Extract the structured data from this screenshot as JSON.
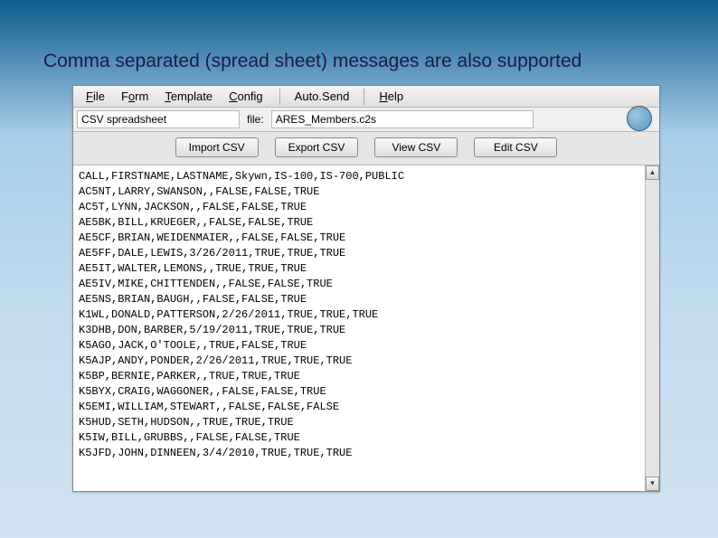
{
  "slide": {
    "title": "Comma separated (spread sheet) messages are also supported"
  },
  "menu": {
    "file": "File",
    "form": "Form",
    "template": "Template",
    "config": "Config",
    "autosend": "Auto.Send",
    "help": "Help"
  },
  "info": {
    "type": "CSV spreadsheet",
    "file_label": "file:",
    "file_name": "ARES_Members.c2s"
  },
  "buttons": {
    "import": "Import CSV",
    "export": "Export CSV",
    "view": "View CSV",
    "edit": "Edit CSV"
  },
  "csv_lines": [
    "CALL,FIRSTNAME,LASTNAME,Skywn,IS-100,IS-700,PUBLIC",
    "AC5NT,LARRY,SWANSON,,FALSE,FALSE,TRUE",
    "AC5T,LYNN,JACKSON,,FALSE,FALSE,TRUE",
    "AE5BK,BILL,KRUEGER,,FALSE,FALSE,TRUE",
    "AE5CF,BRIAN,WEIDENMAIER,,FALSE,FALSE,TRUE",
    "AE5FF,DALE,LEWIS,3/26/2011,TRUE,TRUE,TRUE",
    "AE5IT,WALTER,LEMONS,,TRUE,TRUE,TRUE",
    "AE5IV,MIKE,CHITTENDEN,,FALSE,FALSE,TRUE",
    "AE5NS,BRIAN,BAUGH,,FALSE,FALSE,TRUE",
    "K1WL,DONALD,PATTERSON,2/26/2011,TRUE,TRUE,TRUE",
    "K3DHB,DON,BARBER,5/19/2011,TRUE,TRUE,TRUE",
    "K5AGO,JACK,O'TOOLE,,TRUE,FALSE,TRUE",
    "K5AJP,ANDY,PONDER,2/26/2011,TRUE,TRUE,TRUE",
    "K5BP,BERNIE,PARKER,,TRUE,TRUE,TRUE",
    "K5BYX,CRAIG,WAGGONER,,FALSE,FALSE,TRUE",
    "K5EMI,WILLIAM,STEWART,,FALSE,FALSE,FALSE",
    "K5HUD,SETH,HUDSON,,TRUE,TRUE,TRUE",
    "K5IW,BILL,GRUBBS,,FALSE,FALSE,TRUE",
    "K5JFD,JOHN,DINNEEN,3/4/2010,TRUE,TRUE,TRUE"
  ],
  "scroll": {
    "up": "▴",
    "down": "▾"
  }
}
